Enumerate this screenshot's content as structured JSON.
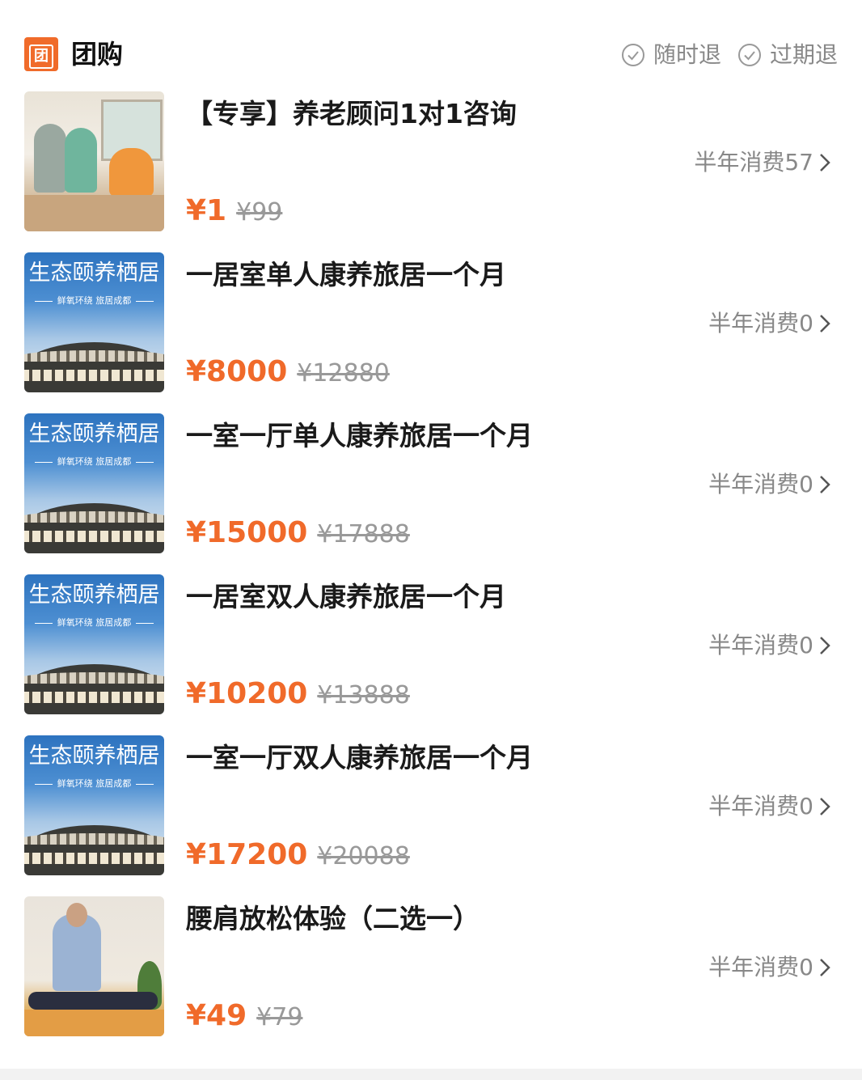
{
  "header": {
    "badge": "团",
    "title": "团购",
    "guarantees": [
      {
        "label": "随时退",
        "icon": "check-circle-icon"
      },
      {
        "label": "过期退",
        "icon": "check-circle-icon"
      }
    ]
  },
  "thumbs": {
    "resort_title": "生态颐养栖居",
    "resort_subtitle": "鲜氧环绕 旅居成都"
  },
  "items": [
    {
      "title": "【专享】养老顾问1对1咨询",
      "spend": "半年消费57",
      "price": "¥1",
      "original_price": "¥99",
      "thumb": "seniors-photo"
    },
    {
      "title": "一居室单人康养旅居一个月",
      "spend": "半年消费0",
      "price": "¥8000",
      "original_price": "¥12880",
      "thumb": "resort-poster"
    },
    {
      "title": "一室一厅单人康养旅居一个月",
      "spend": "半年消费0",
      "price": "¥15000",
      "original_price": "¥17888",
      "thumb": "resort-poster"
    },
    {
      "title": "一居室双人康养旅居一个月",
      "spend": "半年消费0",
      "price": "¥10200",
      "original_price": "¥13888",
      "thumb": "resort-poster"
    },
    {
      "title": "一室一厅双人康养旅居一个月",
      "spend": "半年消费0",
      "price": "¥17200",
      "original_price": "¥20088",
      "thumb": "resort-poster"
    },
    {
      "title": "腰肩放松体验（二选一）",
      "spend": "半年消费0",
      "price": "¥49",
      "original_price": "¥79",
      "thumb": "massage-photo"
    }
  ],
  "colors": {
    "accent": "#f06a2a",
    "muted": "#888888"
  }
}
